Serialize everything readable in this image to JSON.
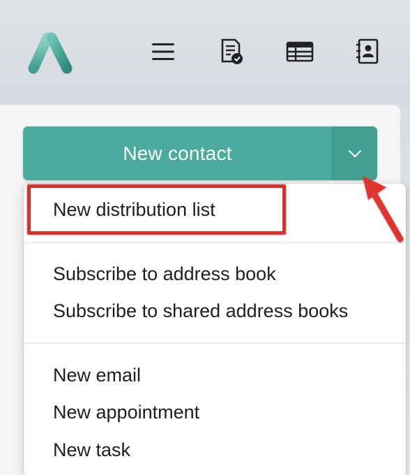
{
  "app": {
    "logo_icon": "app-logo-chevron",
    "accent_color": "#4aab9e"
  },
  "toolbar": {
    "icons": [
      {
        "name": "menu-icon",
        "label": ""
      },
      {
        "name": "tasks-icon",
        "label": ""
      },
      {
        "name": "table-icon",
        "label": ""
      },
      {
        "name": "address-book-icon",
        "label": ""
      }
    ]
  },
  "primary_action": {
    "label": "New contact",
    "dropdown_icon": "chevron-down-icon"
  },
  "dropdown_menu": {
    "group1": [
      "New distribution list"
    ],
    "group2": [
      "Subscribe to address book",
      "Subscribe to shared address books"
    ],
    "group3": [
      "New email",
      "New appointment",
      "New task"
    ]
  },
  "annotation": {
    "highlight_color": "#d9322b",
    "highlighted_item": "New distribution list"
  }
}
